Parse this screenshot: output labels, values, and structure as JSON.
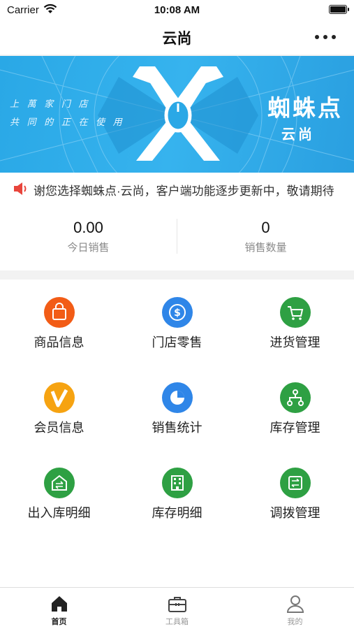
{
  "status_bar": {
    "carrier": "Carrier",
    "time": "10:08 AM"
  },
  "nav": {
    "title": "云尚"
  },
  "banner": {
    "brand": "蜘蛛点",
    "brand_sub": "云尚",
    "script_line1": "上 萬 家 门 店",
    "script_line2": "共 同 的 正 在 使 用",
    "accent_color": "#2aa8e6"
  },
  "notice": {
    "text": "谢您选择蜘蛛点·云尚，客户端功能逐步更新中，敬请期待"
  },
  "stats": [
    {
      "value": "0.00",
      "label": "今日销售"
    },
    {
      "value": "0",
      "label": "销售数量"
    }
  ],
  "menu": [
    {
      "label": "商品信息",
      "icon": "shopping-bag-icon",
      "color": "#f25c16"
    },
    {
      "label": "门店零售",
      "icon": "dollar-coin-icon",
      "color": "#2f86e8"
    },
    {
      "label": "进货管理",
      "icon": "shopping-cart-icon",
      "color": "#2ea043"
    },
    {
      "label": "会员信息",
      "icon": "vip-v-icon",
      "color": "#f6a311"
    },
    {
      "label": "销售统计",
      "icon": "pie-chart-icon",
      "color": "#2f86e8"
    },
    {
      "label": "库存管理",
      "icon": "hierarchy-icon",
      "color": "#2ea043"
    },
    {
      "label": "出入库明细",
      "icon": "transfer-box-icon",
      "color": "#2ea043"
    },
    {
      "label": "库存明细",
      "icon": "building-icon",
      "color": "#2ea043"
    },
    {
      "label": "调拨管理",
      "icon": "exchange-box-icon",
      "color": "#2ea043"
    }
  ],
  "tabs": [
    {
      "label": "首页",
      "icon": "home-icon",
      "active": true
    },
    {
      "label": "工具箱",
      "icon": "toolbox-icon",
      "active": false
    },
    {
      "label": "我的",
      "icon": "user-icon",
      "active": false
    }
  ]
}
